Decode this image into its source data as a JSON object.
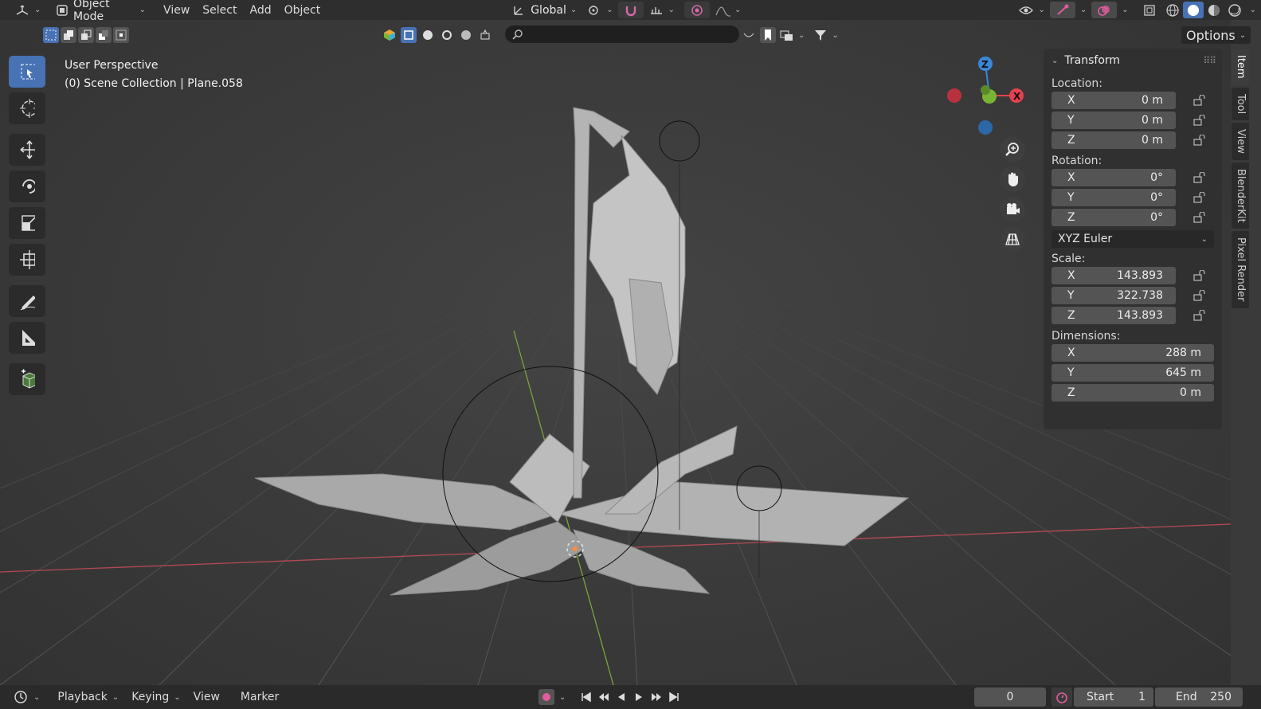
{
  "header": {
    "editor_icon": "3d-viewport-editor-icon",
    "mode": "Object Mode",
    "menus": [
      "View",
      "Select",
      "Add",
      "Object"
    ],
    "orientation": "Global",
    "options_label": "Options"
  },
  "viewport": {
    "perspective": "User Perspective",
    "collection": "(0) Scene Collection | Plane.058"
  },
  "gizmo": {
    "axes": [
      "Z",
      "X"
    ],
    "colors": {
      "x": "#e4414f",
      "y": "#7ab434",
      "z": "#3a86d8"
    }
  },
  "toolbar": {
    "tools": [
      "select-box",
      "cursor",
      "move",
      "rotate",
      "scale",
      "transform",
      "annotate",
      "measure",
      "add-cube"
    ],
    "active": "select-box"
  },
  "npanel": {
    "title": "Transform",
    "location": {
      "label": "Location:",
      "x": "0 m",
      "y": "0 m",
      "z": "0 m"
    },
    "rotation": {
      "label": "Rotation:",
      "x": "0°",
      "y": "0°",
      "z": "0°",
      "mode": "XYZ Euler"
    },
    "scale": {
      "label": "Scale:",
      "x": "143.893",
      "y": "322.738",
      "z": "143.893"
    },
    "dimensions": {
      "label": "Dimensions:",
      "x": "288 m",
      "y": "645 m",
      "z": "0 m"
    },
    "axis_labels": {
      "x": "X",
      "y": "Y",
      "z": "Z"
    }
  },
  "sidetabs": [
    "Item",
    "Tool",
    "View",
    "BlenderKit",
    "Pixel Render"
  ],
  "timeline": {
    "menus": [
      "Playback",
      "Keying",
      "View",
      "Marker"
    ],
    "current_frame": "0",
    "start_label": "Start",
    "start": "1",
    "end_label": "End",
    "end": "250"
  },
  "colors": {
    "accent": "#4772b3",
    "record": "#e05c9e"
  }
}
